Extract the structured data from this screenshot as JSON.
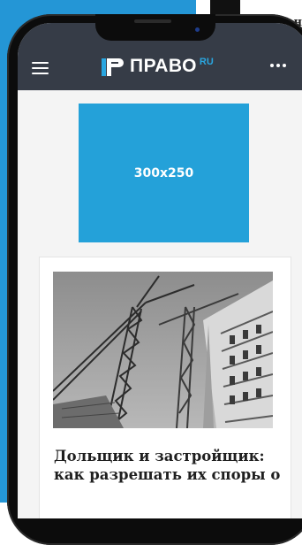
{
  "background": {
    "corner_text": "н"
  },
  "header": {
    "logo_text": "ПРАВО",
    "logo_suffix": "RU",
    "menu_icon": "hamburger-menu-icon",
    "more_icon": "more-dots-icon"
  },
  "ad": {
    "label": "300x250"
  },
  "article": {
    "title": "Дольщик и застройщик: как разрешать их споры о",
    "image_icon": "construction-crane-photo"
  },
  "colors": {
    "page_bg": "#2496d6",
    "appbar": "#363c47",
    "logo_accent": "#2aa6e0",
    "ad_bg": "#24a1d9"
  }
}
